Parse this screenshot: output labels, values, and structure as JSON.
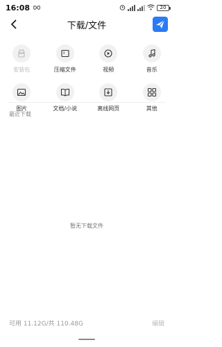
{
  "status_bar": {
    "time": "16:08",
    "battery": "20",
    "icons": [
      "infinity-icon",
      "alarm-icon",
      "signal-icon",
      "signal-icon",
      "wifi-icon",
      "battery-icon"
    ]
  },
  "header": {
    "title": "下载/文件",
    "back_icon": "chevron-left-icon",
    "logo_icon": "app-logo-icon",
    "accent_color": "#2b7cf4"
  },
  "categories": [
    {
      "label": "安装包",
      "icon": "android-icon",
      "disabled": true
    },
    {
      "label": "压缩文件",
      "icon": "archive-icon",
      "disabled": false
    },
    {
      "label": "视频",
      "icon": "play-icon",
      "disabled": false
    },
    {
      "label": "音乐",
      "icon": "music-note-icon",
      "disabled": false
    },
    {
      "label": "图片",
      "icon": "image-icon",
      "disabled": false
    },
    {
      "label": "文档/小说",
      "icon": "book-icon",
      "disabled": false
    },
    {
      "label": "离线网页",
      "icon": "download-page-icon",
      "disabled": false
    },
    {
      "label": "其他",
      "icon": "grid-icon",
      "disabled": false
    }
  ],
  "recent": {
    "section_title": "最近下载",
    "empty_text": "暂无下载文件"
  },
  "footer": {
    "storage_text": "可用 11.12G/共 110.48G",
    "edit_label": "编辑"
  }
}
